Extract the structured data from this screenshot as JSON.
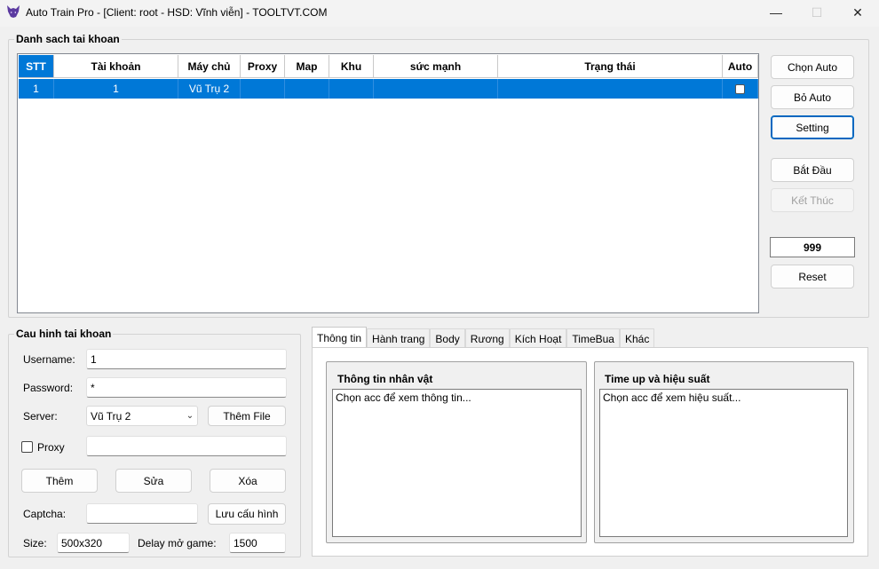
{
  "window": {
    "title": "Auto Train Pro - [Client: root - HSD: Vĩnh viễn] - TOOLTVT.COM",
    "minimize_glyph": "—",
    "maximize_glyph": "☐",
    "close_glyph": "✕",
    "icon": "wolf-logo-icon"
  },
  "accounts": {
    "group_title": "Danh sach tai khoan",
    "columns": [
      "STT",
      "Tài khoản",
      "Máy chủ",
      "Proxy",
      "Map",
      "Khu",
      "sức mạnh",
      "Trạng thái",
      "Auto"
    ],
    "rows": [
      {
        "stt": "1",
        "account": "1",
        "server": "Vũ Trụ 2",
        "proxy": "",
        "map": "",
        "khu": "",
        "power": "",
        "status": "",
        "auto": false
      }
    ]
  },
  "side_buttons": {
    "choose_auto": "Chọn Auto",
    "remove_auto": "Bỏ Auto",
    "setting": "Setting",
    "start": "Bắt Đầu",
    "stop": "Kết Thúc",
    "counter": "999",
    "reset": "Reset"
  },
  "config": {
    "group_title": "Cau hinh tai khoan",
    "username_label": "Username:",
    "username_value": "1",
    "password_label": "Password:",
    "password_value": "*",
    "server_label": "Server:",
    "server_value": "Vũ Trụ 2",
    "add_file": "Thêm File",
    "proxy_label": "Proxy",
    "proxy_value": "",
    "add": "Thêm",
    "edit": "Sửa",
    "delete": "Xóa",
    "captcha_label": "Captcha:",
    "captcha_value": "",
    "save_config": "Lưu cấu hình",
    "size_label": "Size:",
    "size_value": "500x320",
    "delay_label": "Delay mở game:",
    "delay_value": "1500"
  },
  "tabs": [
    "Thông tin",
    "Hành trang",
    "Body",
    "Rương",
    "Kích Hoạt",
    "TimeBua",
    "Khác"
  ],
  "info_panel": {
    "char_title": "Thông tin nhân vật",
    "char_text": "Chọn acc để xem thông tin...",
    "perf_title": "Time up và hiệu suất",
    "perf_text": "Chọn acc để xem hiệu suất..."
  },
  "colors": {
    "selection": "#0078d7",
    "focus": "#0067c0"
  }
}
